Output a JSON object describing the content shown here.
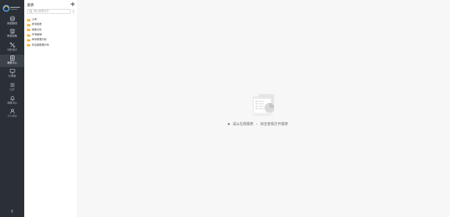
{
  "nav": {
    "items": [
      {
        "id": "data-management",
        "label": "数据管理"
      },
      {
        "id": "data-preparation",
        "label": "数据准备"
      },
      {
        "id": "analysis-design",
        "label": "分析设计"
      },
      {
        "id": "report-center",
        "label": "报表中心"
      },
      {
        "id": "dashboard",
        "label": "仪表盘"
      },
      {
        "id": "portal",
        "label": "门户"
      },
      {
        "id": "notifications",
        "label": "消息中心"
      },
      {
        "id": "account",
        "label": "个人中心"
      }
    ],
    "active": "report-center"
  },
  "panel": {
    "title": "报表",
    "search_placeholder": "输入报表名字",
    "tree": [
      {
        "label": "公司"
      },
      {
        "label": "财务报表"
      },
      {
        "label": "销售分析"
      },
      {
        "label": "市场营销"
      },
      {
        "label": "库存数据分析"
      },
      {
        "label": "供应链数据分析"
      }
    ]
  },
  "main": {
    "empty_hint_left": "请从左侧报表",
    "empty_hint_arrow": "›",
    "empty_hint_right": "双击查看打开报表"
  },
  "colors": {
    "rail_bg": "#2b3036",
    "rail_active": "#3b424a",
    "folder": "#f2b94c",
    "page_bg": "#f7f7f7"
  },
  "icons": {
    "logo": "logo-icon",
    "add": "plus-icon",
    "search": "search-icon",
    "folder": "folder-icon",
    "collapse": "collapse-icon",
    "empty": "empty-report-illustration"
  }
}
